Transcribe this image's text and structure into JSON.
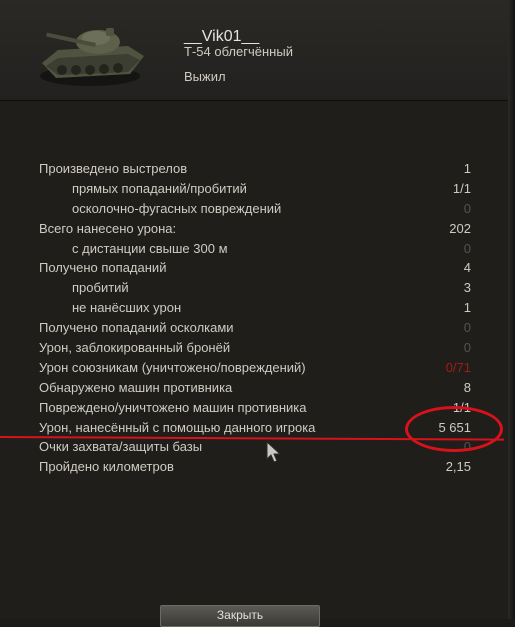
{
  "header": {
    "player_name": "__Vik01__",
    "tank_name": "Т-54 облегчённый",
    "status": "Выжил"
  },
  "stats": [
    {
      "label": "Произведено выстрелов",
      "value": "1",
      "sub": false,
      "style": "normal"
    },
    {
      "label": "прямых попаданий/пробитий",
      "value": "1/1",
      "sub": true,
      "style": "normal"
    },
    {
      "label": "осколочно-фугасных повреждений",
      "value": "0",
      "sub": true,
      "style": "zero"
    },
    {
      "label": "Всего нанесено урона:",
      "value": "202",
      "sub": false,
      "style": "normal"
    },
    {
      "label": "с дистанции свыше 300 м",
      "value": "0",
      "sub": true,
      "style": "zero"
    },
    {
      "label": "Получено попаданий",
      "value": "4",
      "sub": false,
      "style": "normal"
    },
    {
      "label": "пробитий",
      "value": "3",
      "sub": true,
      "style": "normal"
    },
    {
      "label": "не нанёсших урон",
      "value": "1",
      "sub": true,
      "style": "normal"
    },
    {
      "label": "Получено попаданий осколками",
      "value": "0",
      "sub": false,
      "style": "zero"
    },
    {
      "label": "Урон, заблокированный бронёй",
      "value": "0",
      "sub": false,
      "style": "zero"
    },
    {
      "label": "Урон союзникам (уничтожено/повреждений)",
      "value": "0/71",
      "sub": false,
      "style": "red"
    },
    {
      "label": "Обнаружено машин противника",
      "value": "8",
      "sub": false,
      "style": "normal"
    },
    {
      "label": "Повреждено/уничтожено машин противника",
      "value": "1/1",
      "sub": false,
      "style": "normal"
    },
    {
      "label": "Урон, нанесённый с помощью данного игрока",
      "value": "5 651",
      "sub": false,
      "style": "normal"
    },
    {
      "label": "Очки захвата/защиты базы",
      "value": "0",
      "sub": false,
      "style": "zero"
    },
    {
      "label": "Пройдено километров",
      "value": "2,15",
      "sub": false,
      "style": "normal"
    }
  ],
  "buttons": {
    "close_label": "Закрыть"
  },
  "colors": {
    "background": "#1f1e1b",
    "text": "#cfcbc2",
    "muted_value": "#55534e",
    "red_value": "#a21b14",
    "annotation": "#d8121b"
  }
}
